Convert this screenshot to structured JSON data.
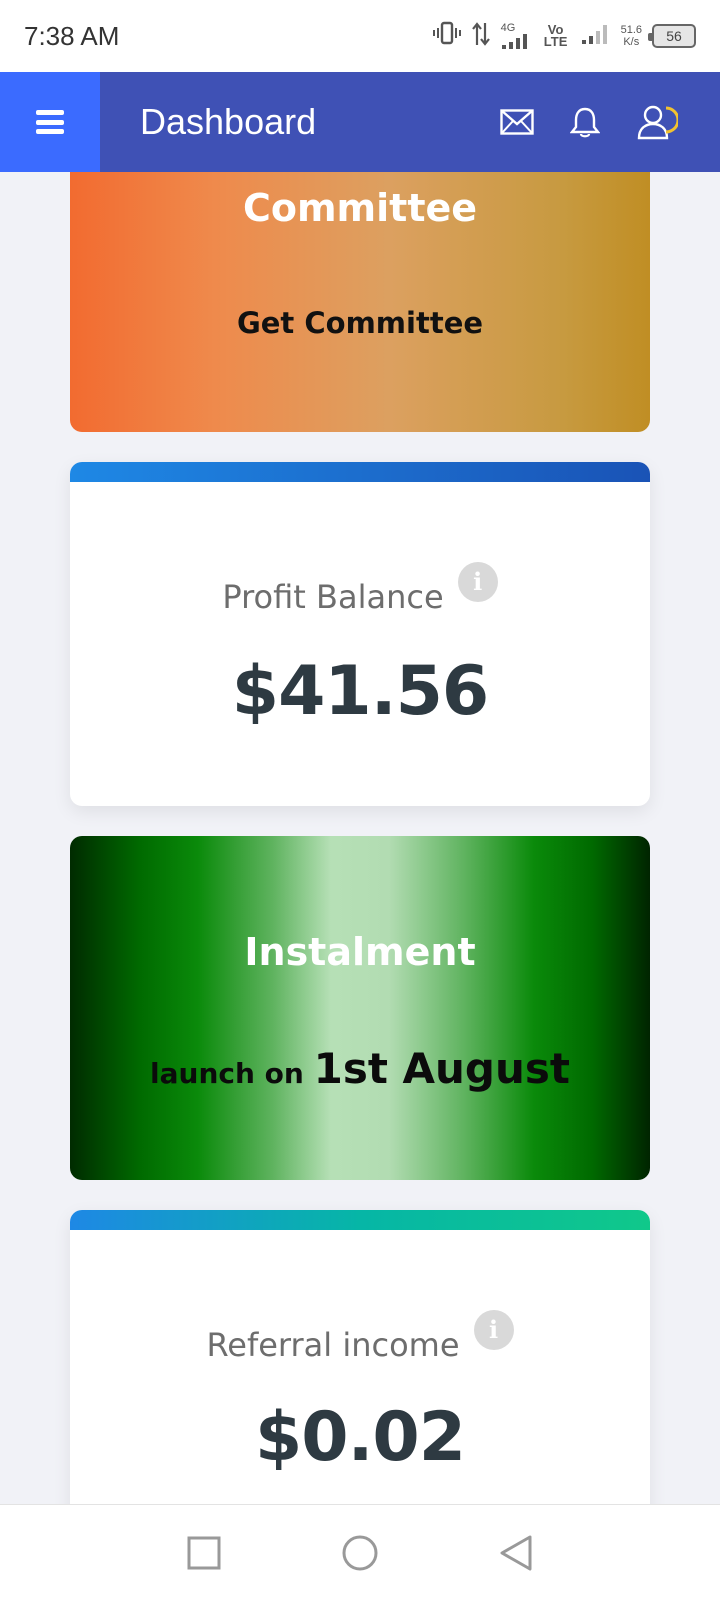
{
  "status_bar": {
    "time": "7:38 AM",
    "network_gen": "4G",
    "volte": "Vo LTE",
    "speed_value": "51.6",
    "speed_unit": "K/s",
    "battery": "56"
  },
  "header": {
    "title": "Dashboard",
    "icons": [
      "menu-icon",
      "mail-icon",
      "bell-icon",
      "user-icon"
    ],
    "color": "#3f51b5",
    "menu_color": "#3b6bff"
  },
  "cards": {
    "committee": {
      "title": "Committee",
      "action": "Get Committee"
    },
    "profit": {
      "label": "Profit Balance",
      "info": "i",
      "value": "$41.56"
    },
    "instalment": {
      "title": "Instalment",
      "launch_prefix": "launch on ",
      "launch_date": "1st August"
    },
    "referral": {
      "label": "Referral income",
      "info": "i",
      "value": "$0.02"
    }
  },
  "nav": {
    "buttons": [
      "recents-square-icon",
      "home-circle-icon",
      "back-triangle-icon"
    ]
  }
}
